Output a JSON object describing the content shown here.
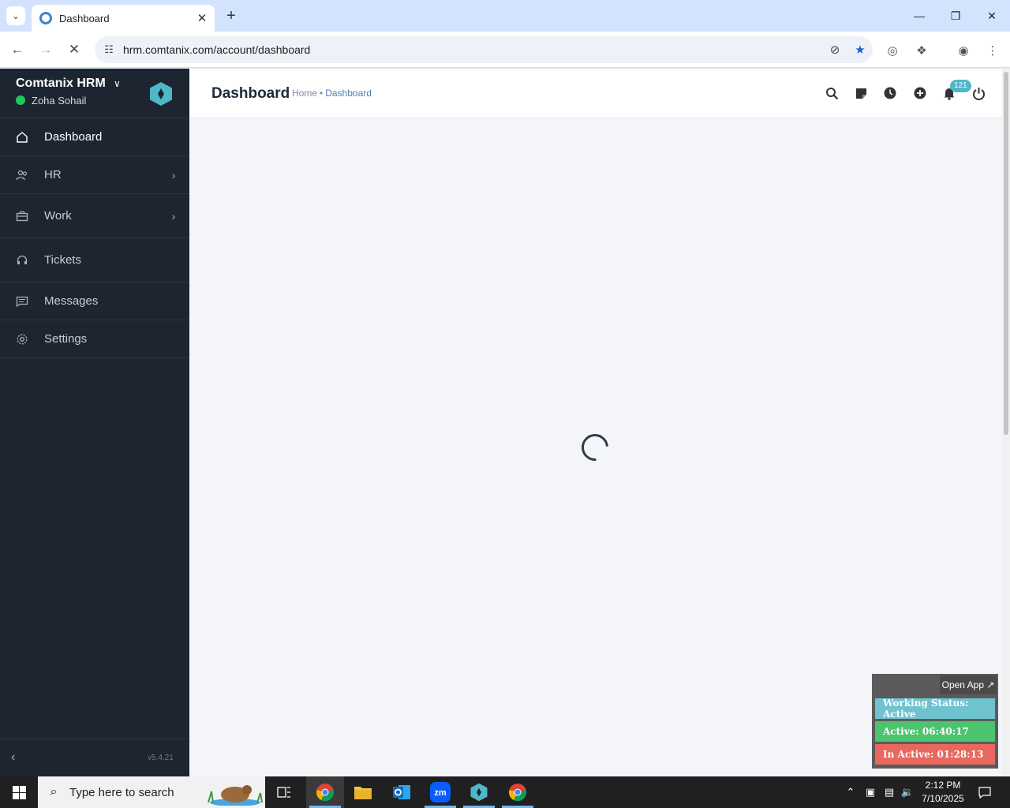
{
  "browser": {
    "tab_title": "Dashboard",
    "url": "hrm.comtanix.com/account/dashboard",
    "new_tab_label": "+"
  },
  "sidebar": {
    "brand": "Comtanix HRM",
    "user": "Zoha Sohail",
    "version": "v5.4.21",
    "items": [
      {
        "label": "Dashboard",
        "icon": "home-icon",
        "active": true,
        "has_children": false
      },
      {
        "label": "HR",
        "icon": "users-icon",
        "has_children": true
      },
      {
        "label": "Work",
        "icon": "briefcase-icon",
        "has_children": true
      },
      {
        "label": "Tickets",
        "icon": "headset-icon",
        "has_children": false
      },
      {
        "label": "Messages",
        "icon": "message-icon",
        "has_children": false
      },
      {
        "label": "Settings",
        "icon": "gear-icon",
        "has_children": false
      }
    ]
  },
  "header": {
    "title": "Dashboard",
    "breadcrumb": [
      "Home",
      "Dashboard"
    ],
    "notification_count": "121"
  },
  "widget": {
    "open_app": "Open App ↗",
    "working_status": "Working Status: Active",
    "active": "Active: 06:40:17",
    "inactive": "In Active: 01:28:13",
    "colors": {
      "status": "#6fc3cf",
      "active": "#4cc46e",
      "inactive": "#e8685e"
    }
  },
  "taskbar": {
    "search_placeholder": "Type here to search",
    "time": "2:12 PM",
    "date": "7/10/2025"
  },
  "colors": {
    "sidebar_bg": "#1d2531",
    "accent": "#4fb7c7",
    "status_online": "#22c55e"
  }
}
